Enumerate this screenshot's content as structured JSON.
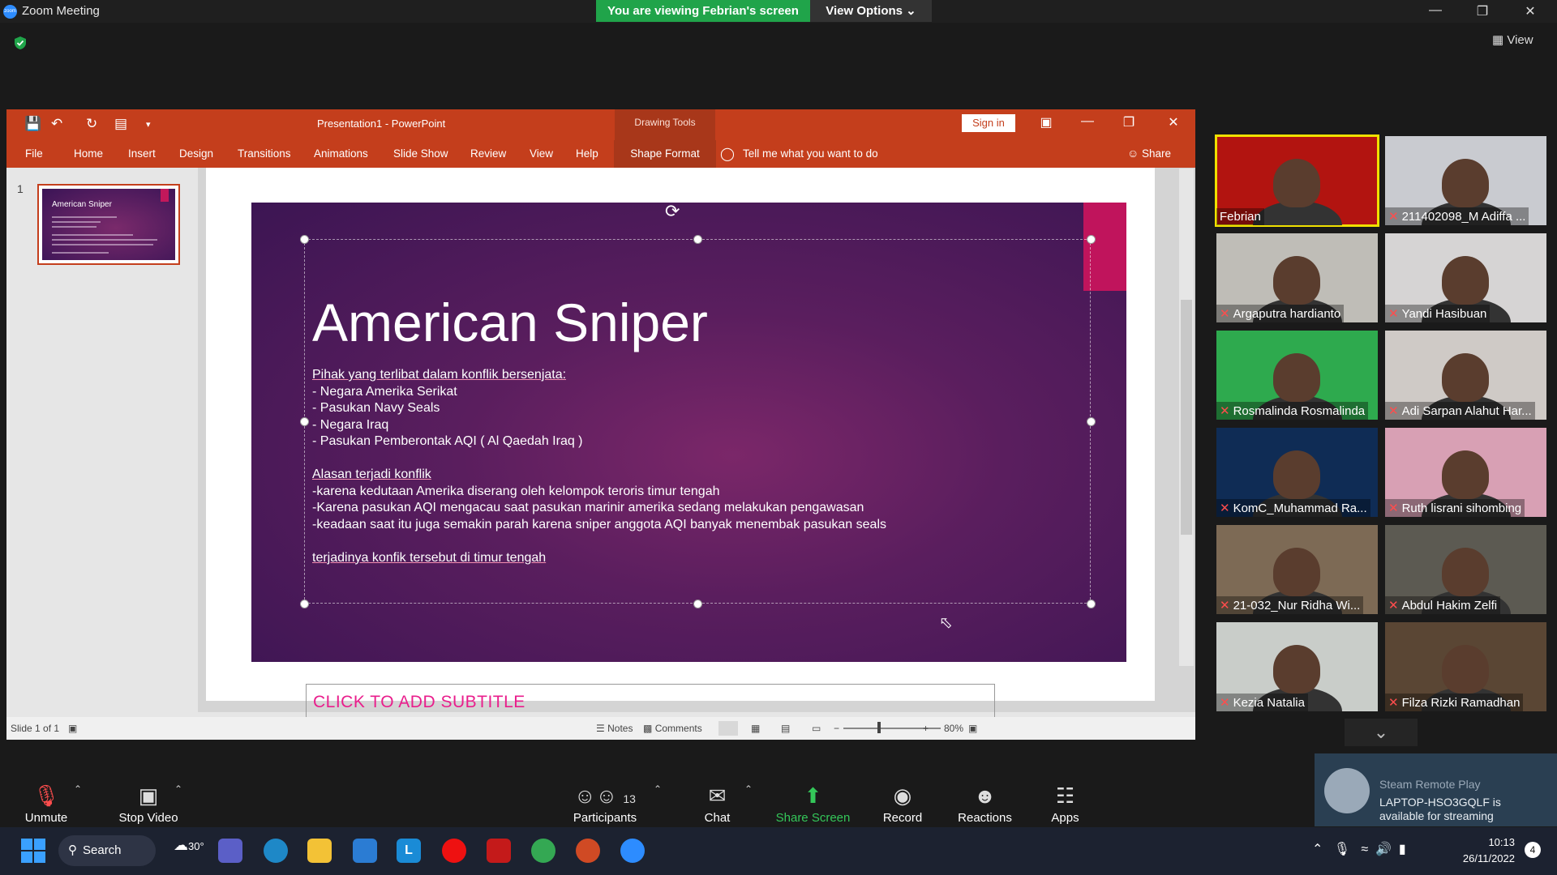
{
  "zoom": {
    "window_title": "Zoom Meeting",
    "logo_text": "zoom",
    "banner": "You are viewing Febrian's screen",
    "view_options": "View Options",
    "view_label": "View"
  },
  "ppt": {
    "doc_title": "Presentation1  -  PowerPoint",
    "drawing_tools": "Drawing Tools",
    "sign_in": "Sign in",
    "tabs": [
      "File",
      "Home",
      "Insert",
      "Design",
      "Transitions",
      "Animations",
      "Slide Show",
      "Review",
      "View",
      "Help"
    ],
    "shape_format": "Shape Format",
    "tell_me": "Tell me what you want to do",
    "share": "Share",
    "thumb_number": "1",
    "thumb_title": "American Sniper",
    "slide": {
      "title": "American Sniper",
      "lines": [
        "Pihak yang terlibat dalam konflik bersenjata:",
        "- Negara Amerika Serikat",
        "- Pasukan Navy Seals",
        "- Negara Iraq",
        "- Pasukan Pemberontak AQI ( Al Qaedah Iraq )",
        "",
        "Alasan terjadi konflik",
        "-karena kedutaan Amerika diserang oleh kelompok teroris timur tengah",
        "-Karena pasukan AQI mengacau saat pasukan marinir amerika sedang melakukan pengawasan",
        "-keadaan saat itu juga semakin parah karena sniper anggota AQI banyak menembak pasukan seals",
        "",
        "terjadinya konfik tersebut di timur tengah"
      ],
      "subtitle": "CLICK TO ADD SUBTITLE"
    },
    "status": {
      "slide_of": "Slide 1 of 1",
      "notes": "Notes",
      "comments": "Comments",
      "zoom": "80%"
    }
  },
  "participants": [
    {
      "name": "Febrian",
      "muted": false,
      "active": true,
      "bg": "#b21410"
    },
    {
      "name": "211402098_M Adiffa ...",
      "muted": true,
      "active": false,
      "bg": "#c9cbd0"
    },
    {
      "name": "Argaputra hardianto",
      "muted": true,
      "active": false,
      "bg": "#bfbdb7"
    },
    {
      "name": "Yandi Hasibuan",
      "muted": true,
      "active": false,
      "bg": "#d6d4d4"
    },
    {
      "name": "Rosmalinda Rosmalinda",
      "muted": true,
      "active": false,
      "bg": "#2eaa4e"
    },
    {
      "name": "Adi Sarpan  Alahut Har...",
      "muted": true,
      "active": false,
      "bg": "#cfcac6"
    },
    {
      "name": "KomC_Muhammad Ra...",
      "muted": true,
      "active": false,
      "bg": "#0f2c55"
    },
    {
      "name": "Ruth lisrani sihombing",
      "muted": true,
      "active": false,
      "bg": "#d8a0b4"
    },
    {
      "name": "21-032_Nur Ridha Wi...",
      "muted": true,
      "active": false,
      "bg": "#7d6a55"
    },
    {
      "name": "Abdul Hakim Zelfi",
      "muted": true,
      "active": false,
      "bg": "#5c5a52"
    },
    {
      "name": "Kezia Natalia",
      "muted": true,
      "active": false,
      "bg": "#c9cdc9"
    },
    {
      "name": "Filza Rizki Ramadhan",
      "muted": true,
      "active": false,
      "bg": "#5a4634"
    }
  ],
  "steam": {
    "title": "Steam Remote Play",
    "message": "LAPTOP-HSO3GQLF is available for streaming"
  },
  "toolbar": {
    "unmute": "Unmute",
    "stop_video": "Stop Video",
    "participants": "Participants",
    "participants_count": "13",
    "chat": "Chat",
    "share_screen": "Share Screen",
    "record": "Record",
    "reactions": "Reactions",
    "apps": "Apps"
  },
  "taskbar": {
    "search": "Search",
    "weather": "30°",
    "time": "10:13",
    "date": "26/11/2022",
    "notifications": "4"
  }
}
